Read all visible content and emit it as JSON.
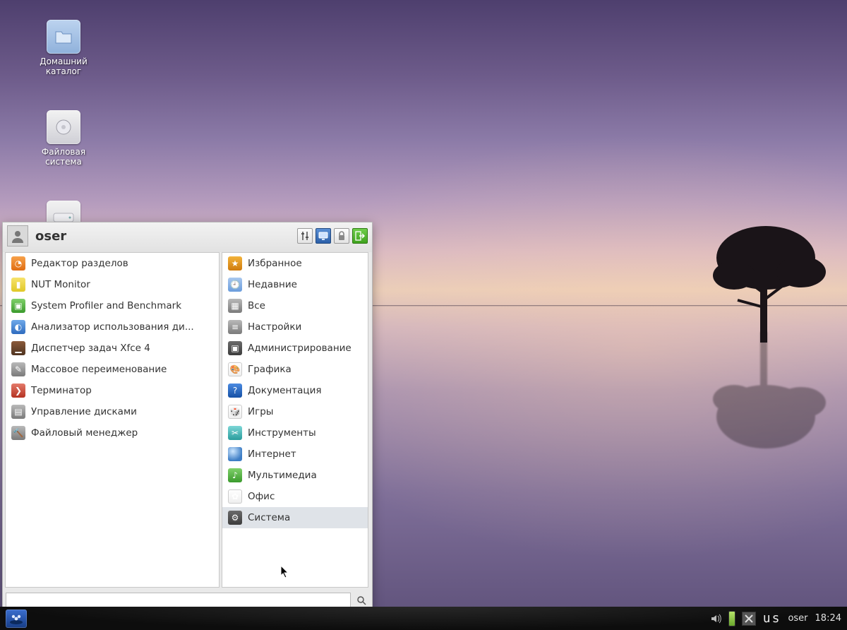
{
  "desktop_icons": [
    {
      "label": "Домашний каталог"
    },
    {
      "label": "Файловая система"
    }
  ],
  "menu": {
    "username": "oser",
    "header_buttons": {
      "settings": "settings-icon",
      "display": "display-icon",
      "lock": "lock-icon",
      "logout": "logout-icon"
    },
    "left_items": [
      {
        "label": "Редактор разделов"
      },
      {
        "label": "NUT Monitor"
      },
      {
        "label": "System Profiler and Benchmark"
      },
      {
        "label": "Анализатор использования ди..."
      },
      {
        "label": "Диспетчер задач Xfce 4"
      },
      {
        "label": "Массовое переименование"
      },
      {
        "label": "Терминатор"
      },
      {
        "label": "Управление дисками"
      },
      {
        "label": "Файловый менеджер"
      }
    ],
    "right_items": [
      {
        "label": "Избранное"
      },
      {
        "label": "Недавние"
      },
      {
        "label": "Все"
      },
      {
        "label": "Настройки"
      },
      {
        "label": "Администрирование"
      },
      {
        "label": "Графика"
      },
      {
        "label": "Документация"
      },
      {
        "label": "Игры"
      },
      {
        "label": "Инструменты"
      },
      {
        "label": "Интернет"
      },
      {
        "label": "Мультимедиа"
      },
      {
        "label": "Офис"
      },
      {
        "label": "Система"
      }
    ],
    "search_placeholder": ""
  },
  "taskbar": {
    "keyboard_layout": "us",
    "user": "oser",
    "clock": "18:24"
  }
}
